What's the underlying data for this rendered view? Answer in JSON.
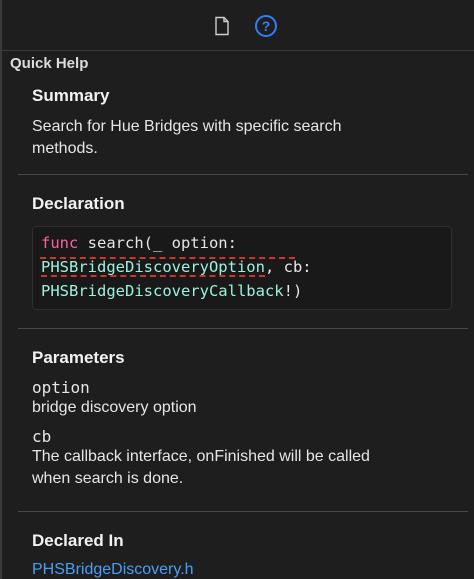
{
  "toolbar": {
    "file_icon": "file-inspector-icon",
    "help_icon": "quick-help-icon",
    "help_accent": "#2f7ff6"
  },
  "panel": {
    "title": "Quick Help"
  },
  "summary": {
    "heading": "Summary",
    "text_line1": "Search for Hue Bridges with specific search",
    "text_line2": "methods."
  },
  "declaration": {
    "heading": "Declaration",
    "kw": "func",
    "line1_rest": " search(_ option:",
    "type1": "PHSBridgeDiscoveryOption",
    "line2_rest": ", cb:",
    "type2": "PHSBridgeDiscoveryCallback",
    "line3_rest": "!)"
  },
  "parameters": {
    "heading": "Parameters",
    "items": [
      {
        "name": "option",
        "desc": "bridge discovery option"
      },
      {
        "name": "cb",
        "desc_line1": "The callback interface, onFinished will be called",
        "desc_line2": "when search is done."
      }
    ]
  },
  "declared_in": {
    "heading": "Declared In",
    "file": "PHSBridgeDiscovery.h"
  }
}
